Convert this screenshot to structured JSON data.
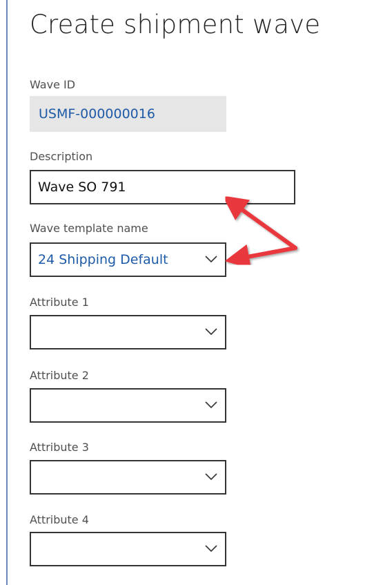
{
  "dialog": {
    "title": "Create shipment wave"
  },
  "fields": {
    "wave_id": {
      "label": "Wave ID",
      "value": "USMF-000000016"
    },
    "description": {
      "label": "Description",
      "value": "Wave SO 791"
    },
    "wave_template": {
      "label": "Wave template name",
      "value": "24 Shipping Default"
    },
    "attribute1": {
      "label": "Attribute 1",
      "value": ""
    },
    "attribute2": {
      "label": "Attribute 2",
      "value": ""
    },
    "attribute3": {
      "label": "Attribute 3",
      "value": ""
    },
    "attribute4": {
      "label": "Attribute 4",
      "value": ""
    }
  },
  "colors": {
    "accent_text": "#1d5aa8",
    "annotation_arrow": "#e8383d",
    "panel_border": "#6d86b8",
    "readonly_bg": "#e6e6e6"
  },
  "icons": {
    "dropdown": "chevron-down-icon",
    "annotation": "red-arrow-annotation"
  }
}
